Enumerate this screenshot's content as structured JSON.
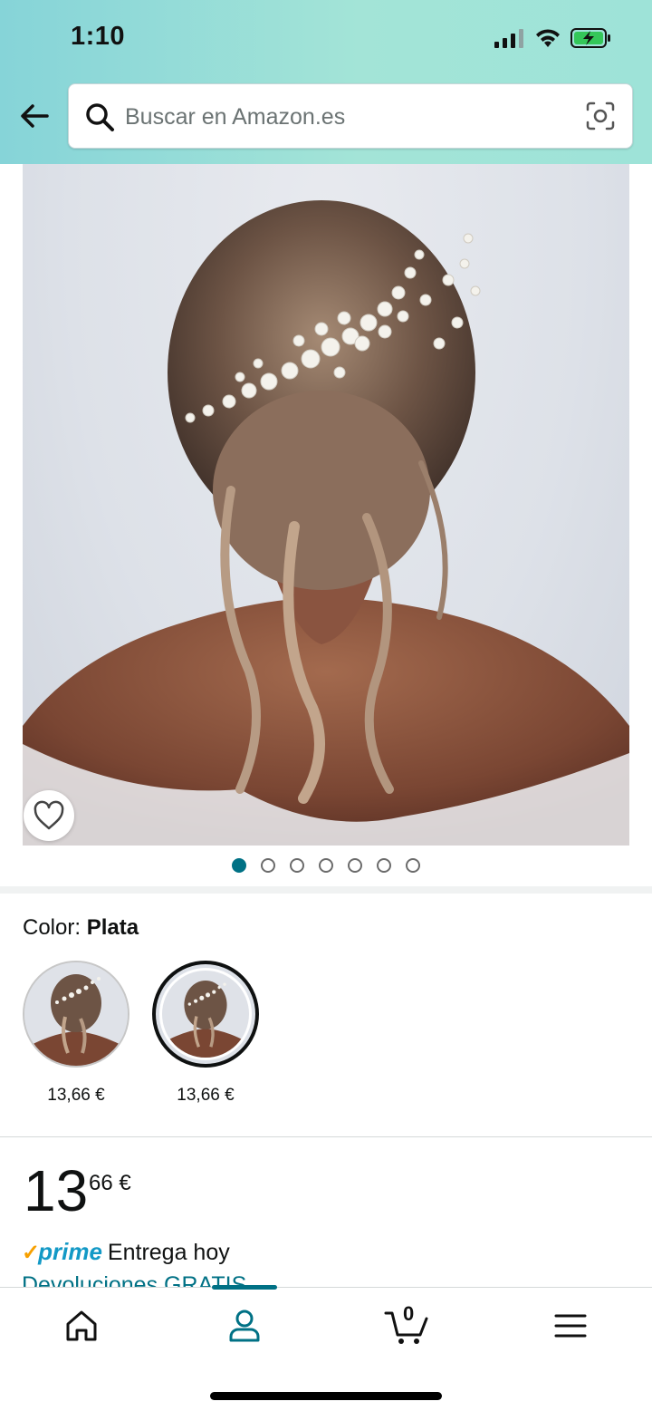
{
  "status_bar": {
    "time": "1:10"
  },
  "search": {
    "placeholder": "Buscar en Amazon.es"
  },
  "carousel": {
    "total_images": 7,
    "active_index": 0
  },
  "color": {
    "label": "Color:",
    "value": "Plata"
  },
  "swatches": [
    {
      "price": "13,66 €",
      "selected": false
    },
    {
      "price": "13,66 €",
      "selected": true
    }
  ],
  "price": {
    "whole": "13",
    "fraction": "66 €"
  },
  "delivery": {
    "prime": "prime",
    "text": "Entrega hoy",
    "returns": "Devoluciones GRATIS"
  },
  "bottom_nav": {
    "cart_count": "0",
    "active_tab": "account"
  },
  "colors": {
    "accent": "#007185",
    "prime_blue": "#1399c6",
    "header_gradient": "#86d4d8"
  },
  "icons": [
    "back-arrow-icon",
    "search-icon",
    "camera-icon",
    "heart-icon",
    "home-icon",
    "account-icon",
    "cart-icon",
    "menu-icon"
  ]
}
